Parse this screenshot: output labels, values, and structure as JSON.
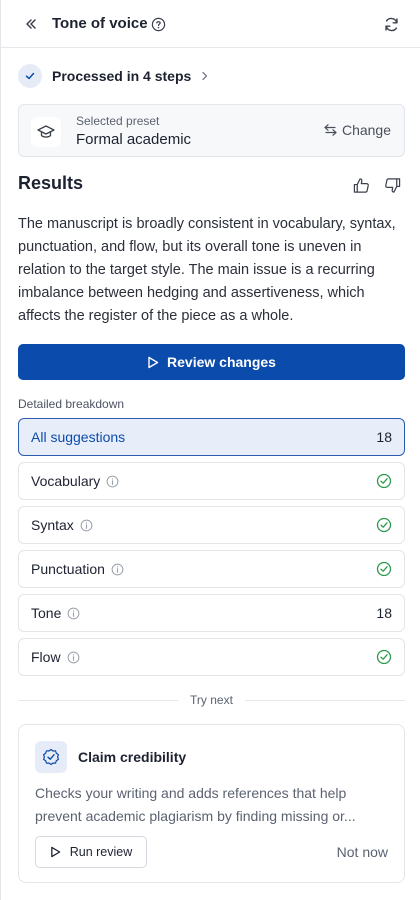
{
  "header": {
    "title": "Tone of voice",
    "icons": {
      "collapse": "double-chevron-left-icon",
      "help": "question-circle-icon",
      "refresh": "refresh-icon"
    }
  },
  "processed": {
    "label": "Processed in 4 steps"
  },
  "preset": {
    "caption": "Selected preset",
    "value": "Formal academic",
    "change_label": "Change"
  },
  "results": {
    "title": "Results",
    "summary": "The manuscript is broadly consistent in vocabulary, syntax, punctuation, and flow, but its overall tone is uneven in relation to the target style. The main issue is a recurring imbalance between hedging and assertiveness, which affects the register of the piece as a whole."
  },
  "review_button": {
    "label": "Review changes"
  },
  "breakdown": {
    "label": "Detailed breakdown",
    "all": {
      "label": "All suggestions",
      "count": "18"
    },
    "items": [
      {
        "label": "Vocabulary",
        "status": "check"
      },
      {
        "label": "Syntax",
        "status": "check"
      },
      {
        "label": "Punctuation",
        "status": "check"
      },
      {
        "label": "Tone",
        "count": "18"
      },
      {
        "label": "Flow",
        "status": "check"
      }
    ]
  },
  "try_next": {
    "label": "Try next",
    "card": {
      "title": "Claim credibility",
      "description": "Checks your writing and adds references that help prevent academic plagiarism by finding missing or...",
      "run_label": "Run review",
      "dismiss_label": "Not now"
    }
  },
  "colors": {
    "primary": "#0b4bab",
    "success": "#2e9a4e",
    "active_bg": "#e8eef9"
  }
}
